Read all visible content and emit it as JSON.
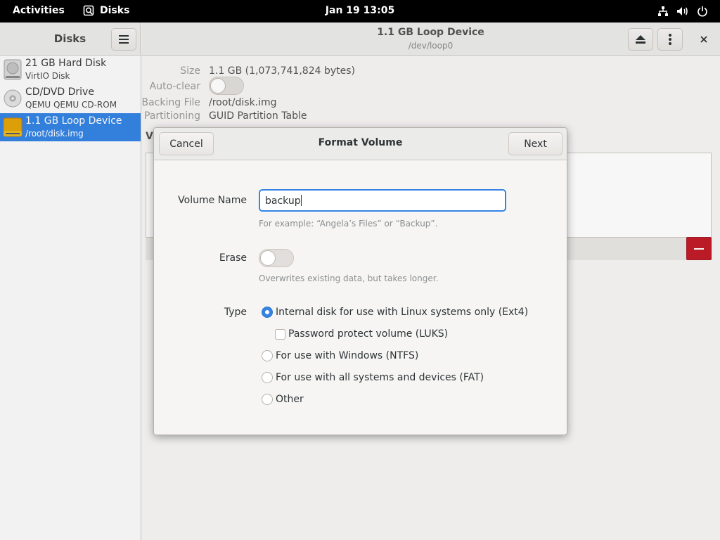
{
  "topbar": {
    "activities": "Activities",
    "app_name": "Disks",
    "clock": "Jan 19  13:05",
    "icons": [
      "network-icon",
      "volume-icon",
      "power-icon"
    ]
  },
  "window": {
    "sidebar_title": "Disks",
    "device_title": "1.1 GB Loop Device",
    "device_subtitle": "/dev/loop0"
  },
  "sidebar": {
    "items": [
      {
        "name": "21 GB Hard Disk",
        "sub": "VirtIO Disk",
        "icon": "hard-disk-icon",
        "selected": false
      },
      {
        "name": "CD/DVD Drive",
        "sub": "QEMU QEMU CD-ROM",
        "icon": "optical-drive-icon",
        "selected": false
      },
      {
        "name": "1.1 GB Loop Device",
        "sub": "/root/disk.img",
        "icon": "loop-device-icon",
        "selected": true
      }
    ]
  },
  "details": {
    "size_label": "Size",
    "size_value": "1.1 GB (1,073,741,824 bytes)",
    "autoclear_label": "Auto-clear",
    "backing_label": "Backing File",
    "backing_value": "/root/disk.img",
    "partitioning_label": "Partitioning",
    "partitioning_value": "GUID Partition Table",
    "volumes_label": "Vo"
  },
  "dialog": {
    "title": "Format Volume",
    "cancel": "Cancel",
    "next": "Next",
    "volume_name_label": "Volume Name",
    "volume_name_value": "backup",
    "volume_name_hint": "For example: “Angela’s Files” or “Backup”.",
    "erase_label": "Erase",
    "erase_on": false,
    "erase_hint": "Overwrites existing data, but takes longer.",
    "type_label": "Type",
    "type_options": [
      {
        "label": "Internal disk for use with Linux systems only (Ext4)",
        "selected": true
      },
      {
        "label": "For use with Windows (NTFS)",
        "selected": false
      },
      {
        "label": "For use with all systems and devices (FAT)",
        "selected": false
      },
      {
        "label": "Other",
        "selected": false
      }
    ],
    "luks_label": "Password protect volume (LUKS)",
    "luks_checked": false
  },
  "colors": {
    "accent": "#3584e4",
    "destructive": "#c01c28",
    "topbar": "#000000"
  }
}
